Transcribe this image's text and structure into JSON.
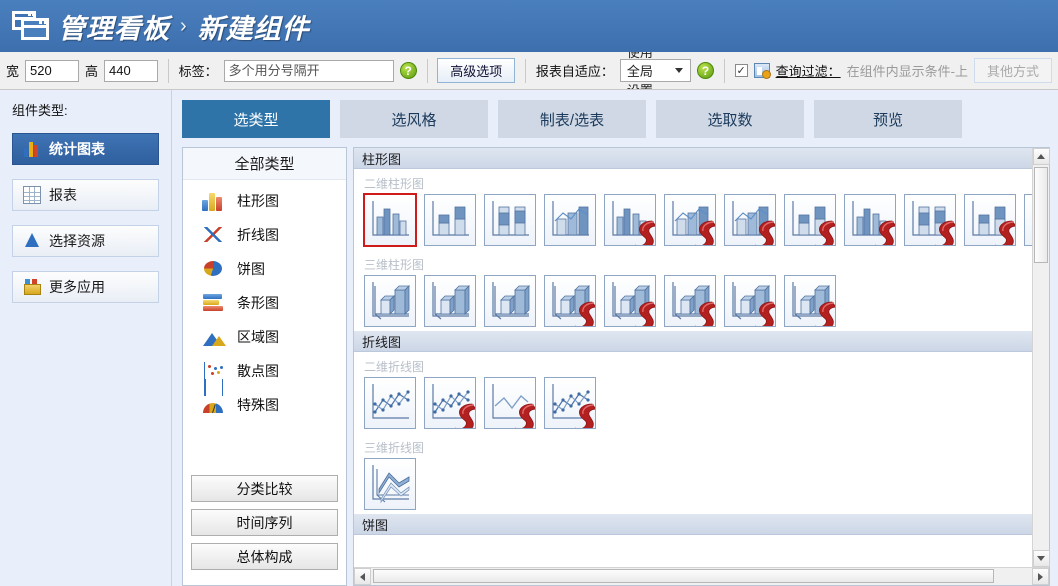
{
  "header": {
    "icon": "windows-stack-icon",
    "breadcrumb_root": "管理看板",
    "separator": "›",
    "breadcrumb_current": "新建组件"
  },
  "toolbar": {
    "width_label": "宽",
    "width_value": "520",
    "height_label": "高",
    "height_value": "440",
    "tag_label": "标签：",
    "tag_placeholder": "多个用分号隔开",
    "tag_value": "",
    "help_glyph": "?",
    "advanced_button": "高级选项",
    "adaptive_label": "报表自适应：",
    "adaptive_value": "使用全局设置",
    "checkbox_glyph": "✓",
    "filter_label": "查询过滤：",
    "filter_value": "在组件内显示条件-上",
    "other_button": "其他方式"
  },
  "sidebar": {
    "title": "组件类型:",
    "items": [
      {
        "label": "统计图表",
        "icon": "bar-chart-icon",
        "active": true
      },
      {
        "label": "报表",
        "icon": "table-icon",
        "active": false
      },
      {
        "label": "选择资源",
        "icon": "cone-icon",
        "active": false
      },
      {
        "label": "更多应用",
        "icon": "apps-icon",
        "active": false
      }
    ]
  },
  "tabs": [
    {
      "label": "选类型",
      "active": true
    },
    {
      "label": "选风格",
      "active": false
    },
    {
      "label": "制表/选表",
      "active": false
    },
    {
      "label": "选取数",
      "active": false
    },
    {
      "label": "预览",
      "active": false
    }
  ],
  "type_list": {
    "header": "全部类型",
    "items": [
      {
        "label": "柱形图",
        "icon": "column-chart-icon"
      },
      {
        "label": "折线图",
        "icon": "line-chart-icon"
      },
      {
        "label": "饼图",
        "icon": "pie-chart-icon"
      },
      {
        "label": "条形图",
        "icon": "bar-chart-icon"
      },
      {
        "label": "区域图",
        "icon": "area-chart-icon"
      },
      {
        "label": "散点图",
        "icon": "scatter-chart-icon"
      },
      {
        "label": "特殊图",
        "icon": "gauge-chart-icon"
      }
    ],
    "buttons": [
      {
        "label": "分类比较"
      },
      {
        "label": "时间序列"
      },
      {
        "label": "总体构成"
      }
    ]
  },
  "gallery": {
    "sections": [
      {
        "title": "柱形图",
        "groups": [
          {
            "title": "二维柱形图",
            "thumbs": [
              {
                "kind": "clustered",
                "flash": false,
                "selected": true
              },
              {
                "kind": "stacked",
                "flash": false,
                "selected": false
              },
              {
                "kind": "percent",
                "flash": false,
                "selected": false
              },
              {
                "kind": "combo",
                "flash": false,
                "selected": false
              },
              {
                "kind": "clustered",
                "flash": true,
                "selected": false
              },
              {
                "kind": "combo",
                "flash": true,
                "selected": false
              },
              {
                "kind": "combo",
                "flash": true,
                "selected": false
              },
              {
                "kind": "stacked",
                "flash": true,
                "selected": false
              },
              {
                "kind": "clustered",
                "flash": true,
                "selected": false
              },
              {
                "kind": "percent",
                "flash": true,
                "selected": false
              },
              {
                "kind": "stacked",
                "flash": true,
                "selected": false
              },
              {
                "kind": "combo",
                "flash": true,
                "selected": false
              }
            ]
          },
          {
            "title": "三维柱形图",
            "thumbs": [
              {
                "kind": "col3d",
                "flash": false,
                "selected": false
              },
              {
                "kind": "col3d",
                "flash": false,
                "selected": false
              },
              {
                "kind": "col3d",
                "flash": false,
                "selected": false
              },
              {
                "kind": "col3d",
                "flash": true,
                "selected": false
              },
              {
                "kind": "col3d",
                "flash": true,
                "selected": false
              },
              {
                "kind": "col3d",
                "flash": true,
                "selected": false
              },
              {
                "kind": "col3d",
                "flash": true,
                "selected": false
              },
              {
                "kind": "col3d",
                "flash": true,
                "selected": false
              }
            ]
          }
        ]
      },
      {
        "title": "折线图",
        "groups": [
          {
            "title": "二维折线图",
            "thumbs": [
              {
                "kind": "line",
                "flash": false,
                "selected": false
              },
              {
                "kind": "line",
                "flash": true,
                "selected": false
              },
              {
                "kind": "lineplain",
                "flash": true,
                "selected": false
              },
              {
                "kind": "line",
                "flash": true,
                "selected": false
              }
            ]
          },
          {
            "title": "三维折线图",
            "thumbs": [
              {
                "kind": "line3d",
                "flash": false,
                "selected": false
              }
            ]
          }
        ]
      },
      {
        "title": "饼图",
        "groups": []
      }
    ]
  },
  "colors": {
    "header_blue": "#4073b4",
    "tab_active": "#2e74a8",
    "sidebar_active": "#3f74b4",
    "selection_red": "#d01b1b",
    "page_bg": "#e8eefa"
  }
}
